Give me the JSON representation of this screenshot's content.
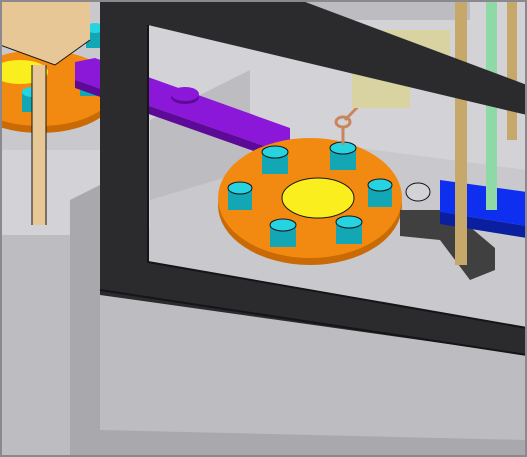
{
  "scene": {
    "colors": {
      "background": "#c9c9cd",
      "frame": "#2b2b2e",
      "frame_edge": "#151517",
      "wall_light": "#d3d3d7",
      "wall_mid": "#bdbdc1",
      "wall_dark": "#a9a9ad",
      "turntable_orange": "#f28a12",
      "turntable_shadow": "#c96a05",
      "cup_yellow": "#fbee1e",
      "post_cyan": "#26d3e0",
      "post_cyan_dark": "#13a7b5",
      "arm_purple": "#8b17d8",
      "arm_purple_dark": "#5e0a98",
      "block_blue": "#0f2ff0",
      "block_blue_dark": "#0a1ea0",
      "rod_tan": "#c7a86b",
      "rod_green": "#8fd9a6",
      "wood_tan": "#e8c796",
      "slider_khaki": "#d8d3a0",
      "spring_copper": "#c9865e",
      "bracket_dark": "#404040"
    }
  }
}
